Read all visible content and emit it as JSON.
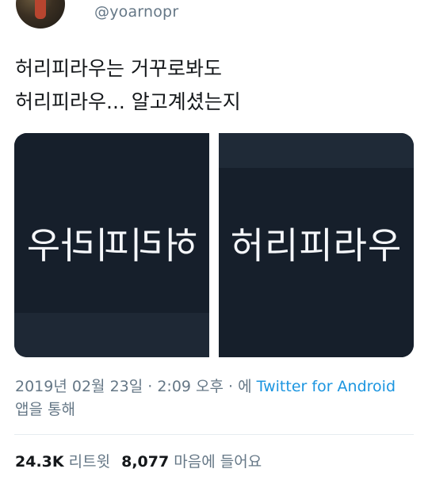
{
  "author": {
    "handle": "@yoarnopr"
  },
  "tweet": {
    "text": "허리피라우는 거꾸로봐도\n허리피라우... 알고계셨는지"
  },
  "media": {
    "left_caption": "허리피라우",
    "right_caption": "허리피라우"
  },
  "meta": {
    "timestamp": "2019년 02월 23일 · 2:09 오후",
    "via_prefix": " · 에 ",
    "source_link": "Twitter for Android",
    "via_suffix": " 앱을 통해"
  },
  "stats": {
    "retweets_count": "24.3K",
    "retweets_label": "리트윗",
    "likes_count": "8,077",
    "likes_label": "마음에 들어요"
  }
}
